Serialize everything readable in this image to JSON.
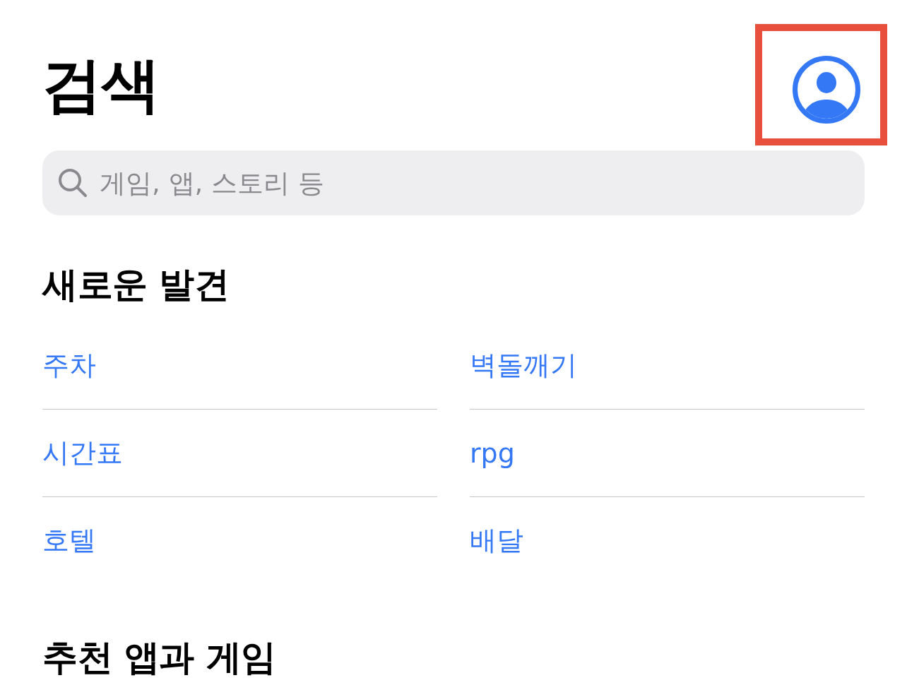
{
  "header": {
    "title": "검색",
    "account_button": {
      "highlighted": true
    }
  },
  "search": {
    "placeholder": "게임, 앱, 스토리 등"
  },
  "sections": [
    {
      "title": "새로운 발견",
      "items": [
        {
          "label": "주차"
        },
        {
          "label": "벽돌깨기"
        },
        {
          "label": "시간표"
        },
        {
          "label": "rpg"
        },
        {
          "label": "호텔"
        },
        {
          "label": "배달"
        }
      ]
    },
    {
      "title": "추천 앱과 게임"
    }
  ]
}
